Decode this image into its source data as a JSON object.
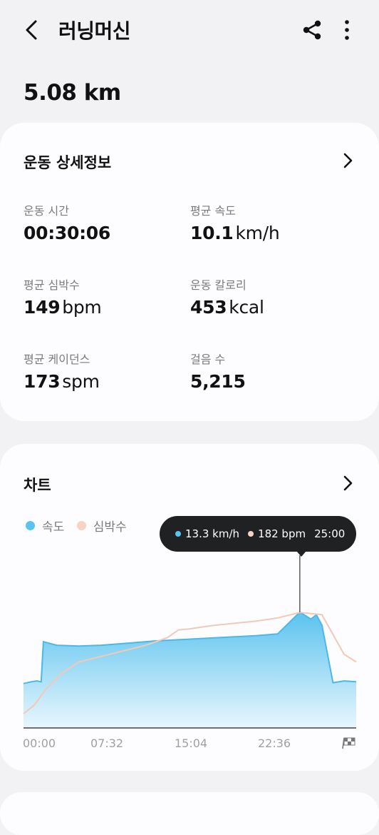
{
  "header": {
    "title": "러닝머신",
    "back_icon": "back-arrow-icon",
    "share_icon": "share-icon",
    "more_icon": "more-vertical-icon"
  },
  "distance": "5.08 km",
  "details": {
    "title": "운동 상세정보",
    "stats": [
      {
        "label": "운동 시간",
        "value": "00:30:06",
        "unit": ""
      },
      {
        "label": "평균 속도",
        "value": "10.1",
        "unit": "km/h"
      },
      {
        "label": "평균 심박수",
        "value": "149",
        "unit": "bpm"
      },
      {
        "label": "운동 칼로리",
        "value": "453",
        "unit": "kcal"
      },
      {
        "label": "평균 케이던스",
        "value": "173",
        "unit": "spm"
      },
      {
        "label": "걸음 수",
        "value": "5,215",
        "unit": ""
      }
    ]
  },
  "chart_section": {
    "title": "차트",
    "legend": [
      {
        "label": "속도",
        "color": "#5bc3ef"
      },
      {
        "label": "심박수",
        "color": "#f6d3c4"
      }
    ],
    "tooltip": {
      "speed": "13.3 km/h",
      "heart_rate": "182 bpm",
      "time": "25:00"
    },
    "finish_icon": "checkered-flag-icon"
  },
  "chart_data": {
    "type": "area",
    "x_ticks": [
      "00:00",
      "07:32",
      "15:04",
      "22:36"
    ],
    "x_min_minutes": 0,
    "x_max_minutes": 30.1,
    "series": [
      {
        "name": "속도",
        "unit": "km/h",
        "color": "#5bc3ef",
        "points": [
          [
            0,
            5.1
          ],
          [
            0.7,
            5.3
          ],
          [
            1.2,
            5.4
          ],
          [
            1.6,
            5.3
          ],
          [
            1.8,
            9.9
          ],
          [
            3,
            9.5
          ],
          [
            5,
            9.4
          ],
          [
            7,
            9.5
          ],
          [
            9,
            9.7
          ],
          [
            12,
            10
          ],
          [
            15,
            10.2
          ],
          [
            18,
            10.4
          ],
          [
            21,
            10.6
          ],
          [
            23,
            10.8
          ],
          [
            25,
            13.3
          ],
          [
            26,
            12.5
          ],
          [
            26.5,
            13.0
          ],
          [
            27,
            11.8
          ],
          [
            28,
            5.2
          ],
          [
            29,
            5.4
          ],
          [
            30.1,
            5.3
          ]
        ]
      },
      {
        "name": "심박수",
        "unit": "bpm",
        "color": "#f6d3c4",
        "points": [
          [
            0,
            88
          ],
          [
            1,
            96
          ],
          [
            2,
            110
          ],
          [
            3.5,
            125
          ],
          [
            5,
            135
          ],
          [
            7,
            140
          ],
          [
            9,
            145
          ],
          [
            11,
            150
          ],
          [
            13,
            157
          ],
          [
            14,
            164
          ],
          [
            15,
            165
          ],
          [
            17,
            168
          ],
          [
            19,
            170
          ],
          [
            21,
            172
          ],
          [
            23,
            175
          ],
          [
            25,
            180
          ],
          [
            27,
            178
          ],
          [
            28,
            160
          ],
          [
            29,
            142
          ],
          [
            30.1,
            135
          ]
        ]
      }
    ],
    "highlight": {
      "x_label": "25:00",
      "speed": 13.3,
      "heart_rate": 182
    }
  }
}
